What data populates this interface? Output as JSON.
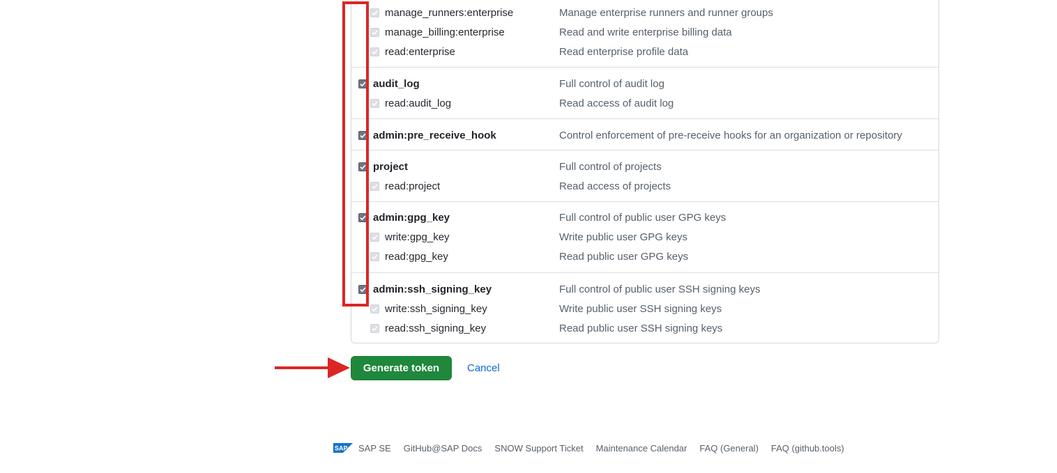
{
  "scopes": {
    "groups": [
      {
        "children": [
          {
            "name": "manage_runners:enterprise",
            "desc": "Manage enterprise runners and runner groups"
          },
          {
            "name": "manage_billing:enterprise",
            "desc": "Read and write enterprise billing data"
          },
          {
            "name": "read:enterprise",
            "desc": "Read enterprise profile data"
          }
        ]
      },
      {
        "parent": {
          "name": "audit_log",
          "desc": "Full control of audit log"
        },
        "children": [
          {
            "name": "read:audit_log",
            "desc": "Read access of audit log"
          }
        ]
      },
      {
        "parent": {
          "name": "admin:pre_receive_hook",
          "desc": "Control enforcement of pre-receive hooks for an organization or repository"
        }
      },
      {
        "parent": {
          "name": "project",
          "desc": "Full control of projects"
        },
        "children": [
          {
            "name": "read:project",
            "desc": "Read access of projects"
          }
        ]
      },
      {
        "parent": {
          "name": "admin:gpg_key",
          "desc": "Full control of public user GPG keys"
        },
        "children": [
          {
            "name": "write:gpg_key",
            "desc": "Write public user GPG keys"
          },
          {
            "name": "read:gpg_key",
            "desc": "Read public user GPG keys"
          }
        ]
      },
      {
        "parent": {
          "name": "admin:ssh_signing_key",
          "desc": "Full control of public user SSH signing keys"
        },
        "children": [
          {
            "name": "write:ssh_signing_key",
            "desc": "Write public user SSH signing keys"
          },
          {
            "name": "read:ssh_signing_key",
            "desc": "Read public user SSH signing keys"
          }
        ]
      }
    ]
  },
  "actions": {
    "generate_label": "Generate token",
    "cancel_label": "Cancel"
  },
  "footer": {
    "logo_text": "SAP",
    "links": [
      "SAP SE",
      "GitHub@SAP Docs",
      "SNOW Support Ticket",
      "Maintenance Calendar",
      "FAQ (General)",
      "FAQ (github.tools)"
    ]
  },
  "colors": {
    "primary": "#1f883d",
    "link": "#0969da",
    "annotation": "#dc2626",
    "sap_blue": "#1a73c8"
  },
  "icons": {
    "check": "check-icon",
    "arrow": "arrow-right-icon",
    "logo": "sap-logo-icon"
  }
}
